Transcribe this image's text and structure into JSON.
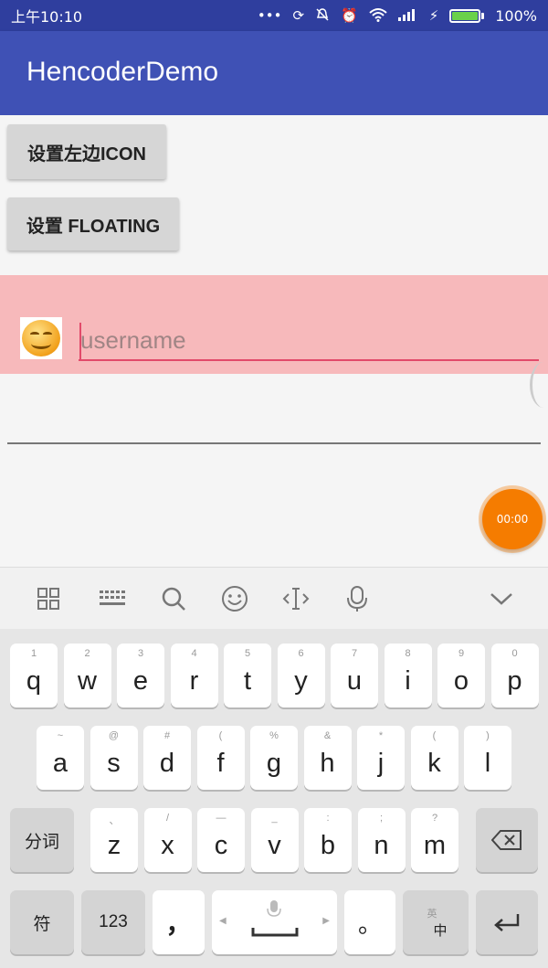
{
  "status_bar": {
    "time": "上午10:10",
    "battery_percent_label": "100%",
    "battery_level": 1.0,
    "icons": [
      "dots-icon",
      "sync-icon",
      "mute-icon",
      "alarm-icon",
      "wifi-icon",
      "signal-icon",
      "charging-icon",
      "battery-icon"
    ]
  },
  "app_bar": {
    "title": "HencoderDemo"
  },
  "buttons": {
    "set_left_icon": "设置左边ICON",
    "set_floating": "设置 FLOATING"
  },
  "username_field": {
    "placeholder": "username",
    "value": ""
  },
  "fab": {
    "label": "00:00",
    "color": "#f57c00"
  },
  "keyboard": {
    "toolbar": [
      "grid-icon",
      "keyboard-icon",
      "search-icon",
      "emoji-icon",
      "cursor-icon",
      "mic-icon",
      "collapse-icon"
    ],
    "row1": [
      {
        "hint": "1",
        "key": "q"
      },
      {
        "hint": "2",
        "key": "w"
      },
      {
        "hint": "3",
        "key": "e"
      },
      {
        "hint": "4",
        "key": "r"
      },
      {
        "hint": "5",
        "key": "t"
      },
      {
        "hint": "6",
        "key": "y"
      },
      {
        "hint": "7",
        "key": "u"
      },
      {
        "hint": "8",
        "key": "i"
      },
      {
        "hint": "9",
        "key": "o"
      },
      {
        "hint": "0",
        "key": "p"
      }
    ],
    "row2": [
      {
        "hint": "~",
        "key": "a"
      },
      {
        "hint": "@",
        "key": "s"
      },
      {
        "hint": "#",
        "key": "d"
      },
      {
        "hint": "(",
        "key": "f"
      },
      {
        "hint": "%",
        "key": "g"
      },
      {
        "hint": "&",
        "key": "h"
      },
      {
        "hint": "*",
        "key": "j"
      },
      {
        "hint": "(",
        "key": "k"
      },
      {
        "hint": ")",
        "key": "l"
      }
    ],
    "row3": [
      {
        "hint": "、",
        "key": "z"
      },
      {
        "hint": "/",
        "key": "x"
      },
      {
        "hint": "—",
        "key": "c"
      },
      {
        "hint": "_",
        "key": "v"
      },
      {
        "hint": ":",
        "key": "b"
      },
      {
        "hint": ";",
        "key": "n"
      },
      {
        "hint": "?",
        "key": "m"
      }
    ],
    "fenci": "分词",
    "symbol": "符",
    "num": "123",
    "comma": "，",
    "period": "。",
    "lang_top": "英",
    "lang_bottom": "中",
    "accent_color": "#3f51b5"
  },
  "colors": {
    "status_bar": "#2f3e9e",
    "app_bar": "#3f51b5",
    "pink_row": "#f7b9bb",
    "underline": "#e24a6a"
  }
}
